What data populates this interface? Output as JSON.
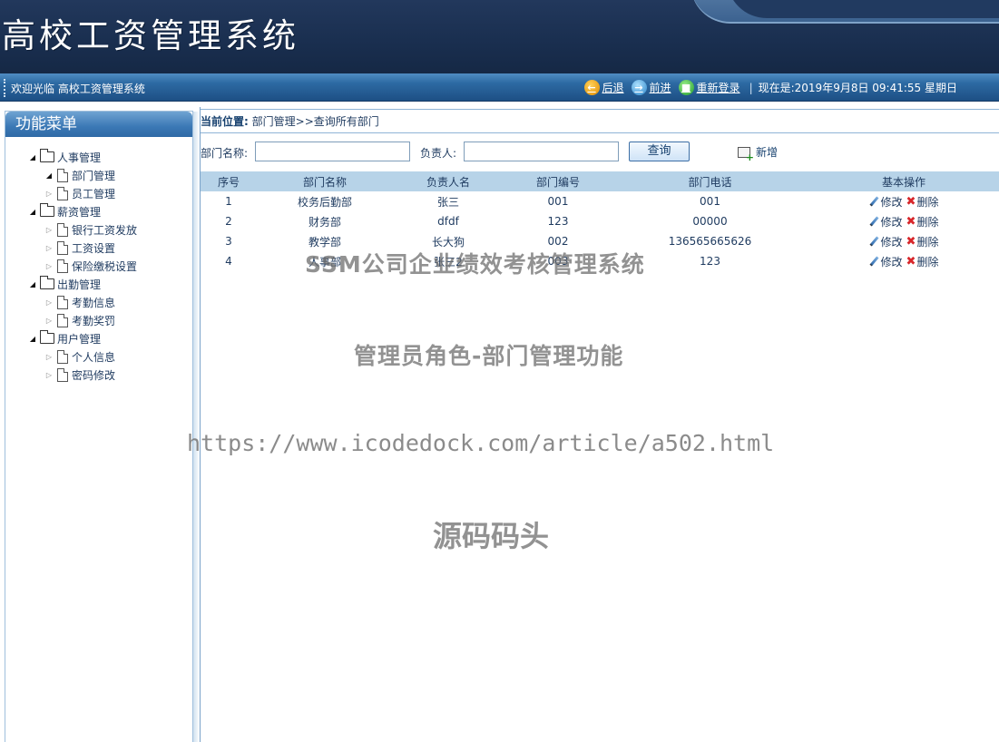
{
  "header": {
    "app_title": "高校工资管理系统",
    "welcome": "欢迎光临 高校工资管理系统",
    "back_label": "后退",
    "forward_label": "前进",
    "relogin_label": "重新登录",
    "now_text": "现在是:2019年9月8日 09:41:55 星期日"
  },
  "sidebar": {
    "title": "功能菜单",
    "groups": [
      {
        "label": "人事管理",
        "items": [
          "部门管理",
          "员工管理"
        ]
      },
      {
        "label": "薪资管理",
        "items": [
          "银行工资发放",
          "工资设置",
          "保险缴税设置"
        ]
      },
      {
        "label": "出勤管理",
        "items": [
          "考勤信息",
          "考勤奖罚"
        ]
      },
      {
        "label": "用户管理",
        "items": [
          "个人信息",
          "密码修改"
        ]
      }
    ]
  },
  "breadcrumb": {
    "label": "当前位置:",
    "path": "部门管理>>查询所有部门"
  },
  "search": {
    "dept_name_label": "部门名称:",
    "dept_name_value": "",
    "leader_label": "负责人:",
    "leader_value": "",
    "query_label": "查询",
    "add_label": "新增"
  },
  "table": {
    "headers": [
      "序号",
      "部门名称",
      "负责人名",
      "部门编号",
      "部门电话",
      "基本操作"
    ],
    "edit_label": "修改",
    "delete_label": "删除",
    "rows": [
      [
        "1",
        "校务后勤部",
        "张三",
        "001",
        "001"
      ],
      [
        "2",
        "财务部",
        "dfdf",
        "123",
        "00000"
      ],
      [
        "3",
        "教学部",
        "长大狗",
        "002",
        "136565665626"
      ],
      [
        "4",
        "人事部",
        "张三2",
        "003",
        "123"
      ]
    ]
  },
  "watermarks": {
    "line1": "SSM公司企业绩效考核管理系统",
    "line2": "管理员角色-部门管理功能",
    "line3": "https://www.icodedock.com/article/a502.html",
    "line4": "源码码头"
  },
  "colors": {
    "header_bg": "#1a2f50",
    "welcome_bar": "#2d6aa3",
    "table_header": "#b7d3e8",
    "text": "#1e3a5f",
    "delete_icon": "#d8262a"
  }
}
